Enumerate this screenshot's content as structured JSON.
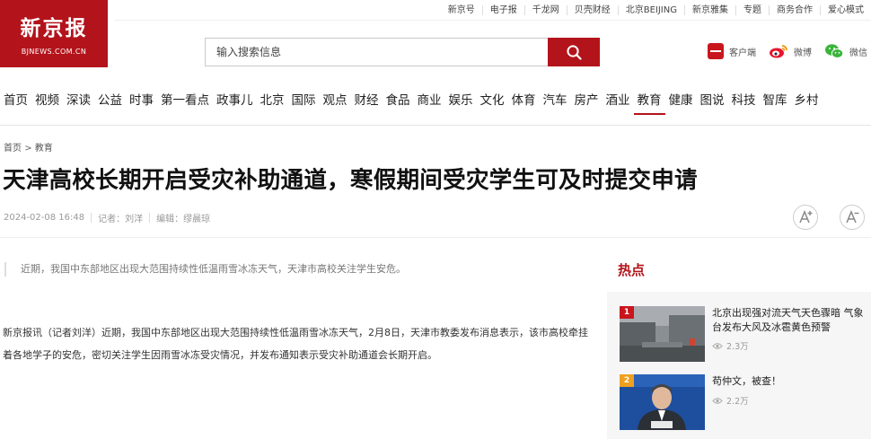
{
  "brand": {
    "name": "新京报",
    "domain": "BJNEWS.COM.CN",
    "color": "#b3141b"
  },
  "util_bar": [
    "新京号",
    "电子报",
    "千龙网",
    "贝壳财经",
    "北京BEIJING",
    "新京雅集",
    "专题",
    "商务合作",
    "爱心模式"
  ],
  "search": {
    "placeholder": "输入搜索信息",
    "icon": "search-icon"
  },
  "apps": [
    {
      "label": "客户端",
      "icon": "app-icon"
    },
    {
      "label": "微博",
      "icon": "weibo-icon"
    },
    {
      "label": "微信",
      "icon": "wechat-icon"
    }
  ],
  "nav": {
    "items": [
      "首页",
      "视频",
      "深读",
      "公益",
      "时事",
      "第一看点",
      "政事儿",
      "北京",
      "国际",
      "观点",
      "财经",
      "食品",
      "商业",
      "娱乐",
      "文化",
      "体育",
      "汽车",
      "房产",
      "酒业",
      "教育",
      "健康",
      "图说",
      "科技",
      "智库",
      "乡村"
    ],
    "active": "教育"
  },
  "breadcrumb": {
    "home": "首页",
    "sep": ">",
    "current": "教育"
  },
  "article": {
    "title": "天津高校长期开启受灾补助通道，寒假期间受灾学生可及时提交申请",
    "datetime": "2024-02-08 16:48",
    "reporter": "记者：刘洋",
    "editor": "编辑：缪晨琼",
    "summary": "近期，我国中东部地区出现大范围持续性低温雨雪冰冻天气，天津市高校关注学生安危。",
    "body": "新京报讯（记者刘洋）近期，我国中东部地区出现大范围持续性低温雨雪冰冻天气，2月8日，天津市教委发布消息表示，该市高校牵挂着各地学子的安危，密切关注学生因雨雪冰冻受灾情况，并发布通知表示受灾补助通道会长期开启。"
  },
  "font_buttons": [
    "font-increase-icon",
    "font-decrease-icon"
  ],
  "hot": {
    "title": "热点",
    "items": [
      {
        "rank": "1",
        "rank_color": "#c8161d",
        "text": "北京出现强对流天气天色骤暗 气象台发布大风及冰雹黄色预警",
        "views": "2.3万"
      },
      {
        "rank": "2",
        "rank_color": "#f0a020",
        "text": "苟仲文，被查！",
        "views": "2.2万"
      }
    ]
  }
}
